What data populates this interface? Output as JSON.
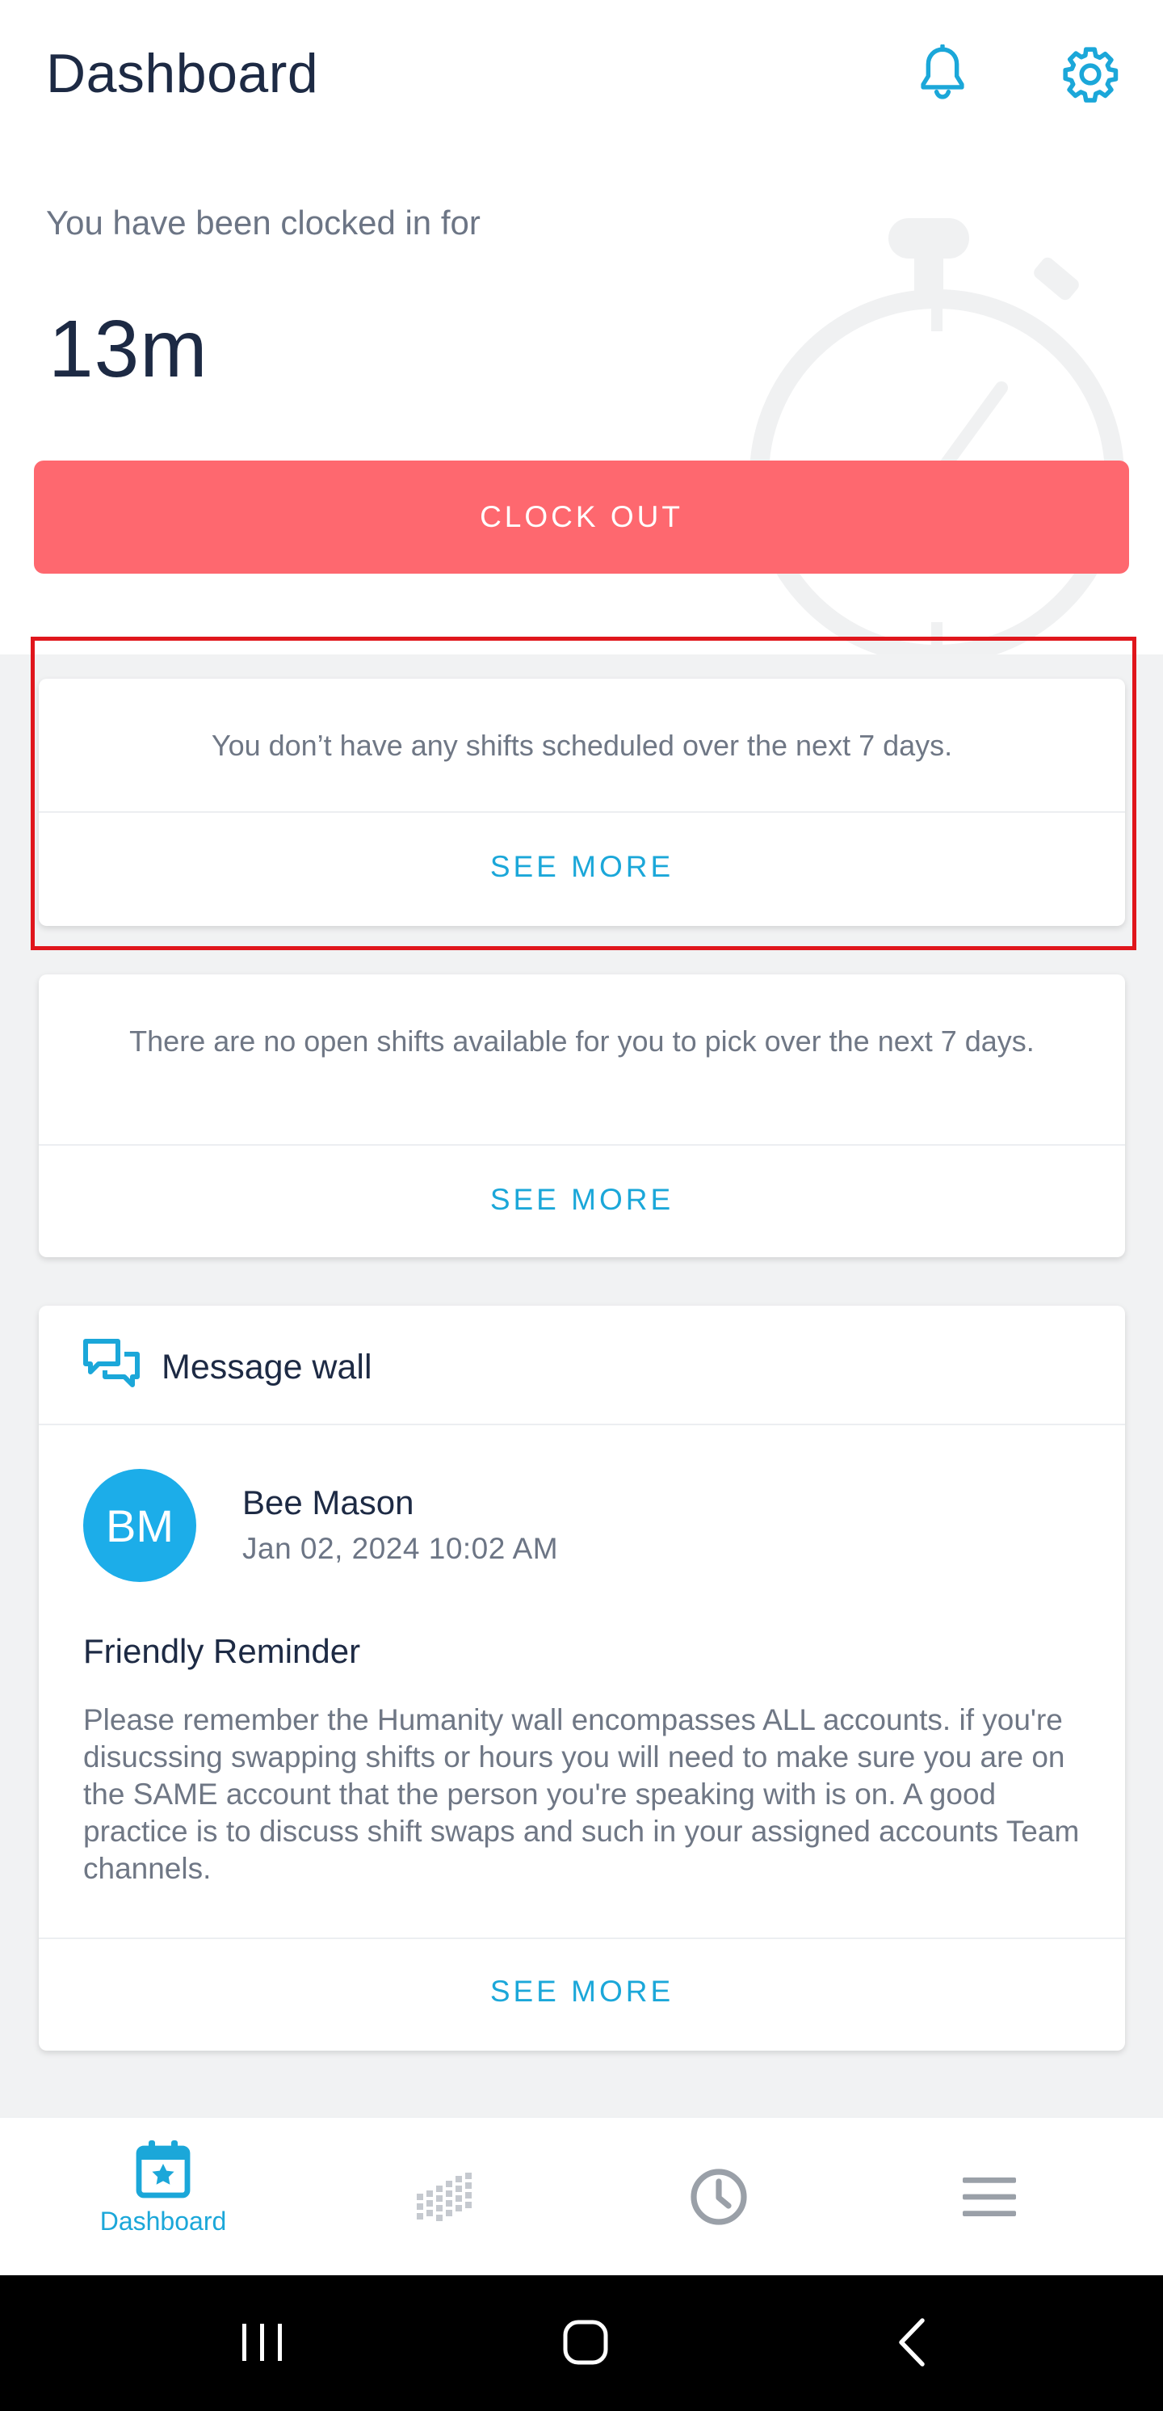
{
  "header": {
    "title": "Dashboard",
    "icons": [
      "bell-icon",
      "gear-icon"
    ]
  },
  "clock": {
    "label": "You have been clocked in for",
    "value": "13m",
    "button_label": "CLOCK OUT"
  },
  "shifts_card": {
    "text": "You don’t have any shifts scheduled over the next 7 days.",
    "see_more": "SEE MORE"
  },
  "open_shifts_card": {
    "text": "There are no open shifts available for you to pick over the next 7 days.",
    "see_more": "SEE MORE"
  },
  "message_wall": {
    "title": "Message wall",
    "post": {
      "avatar_initials": "BM",
      "author": "Bee Mason",
      "date": "Jan 02, 2024 10:02 AM",
      "title": "Friendly Reminder",
      "body": "Please remember the Humanity wall encompasses ALL accounts. if you're disucssing swapping shifts or hours you will need to make sure you are on the SAME account that the person you're speaking with is on. A good practice is to discuss shift swaps and such in your assigned accounts Team channels."
    },
    "see_more": "SEE MORE"
  },
  "bottom_nav": {
    "items": [
      {
        "label": "Dashboard",
        "icon": "calendar-star-icon",
        "active": true
      },
      {
        "label": "",
        "icon": "schedule-grid-icon",
        "active": false
      },
      {
        "label": "",
        "icon": "clock-icon",
        "active": false
      },
      {
        "label": "",
        "icon": "menu-icon",
        "active": false
      }
    ]
  },
  "colors": {
    "accent": "#1ba7d9",
    "clock_out": "#fe686f",
    "highlight": "#e0161c"
  }
}
